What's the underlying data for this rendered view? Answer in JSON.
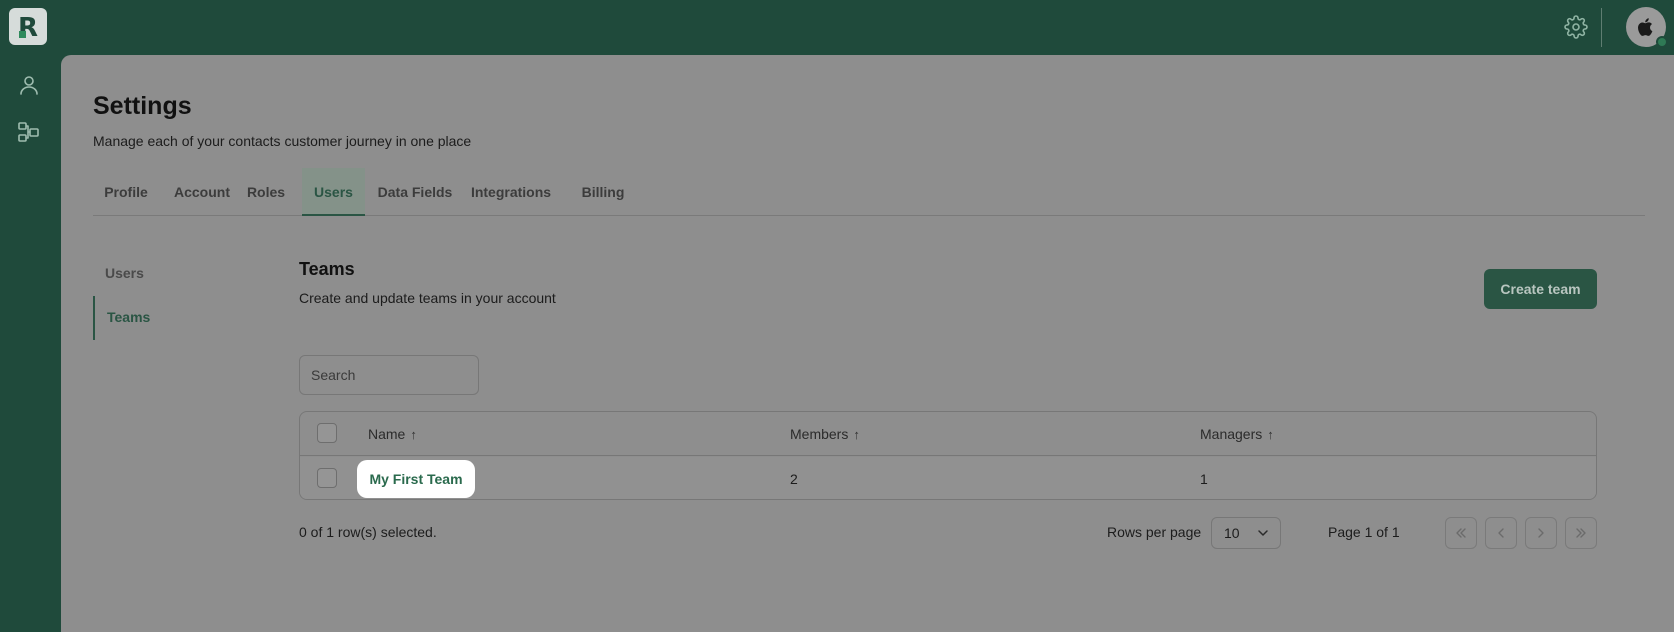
{
  "topbar": {
    "logo_letter": "R",
    "icons": [
      "gear-icon",
      "apple-icon"
    ]
  },
  "rail": {
    "icons": [
      "user-icon",
      "org-chart-icon"
    ]
  },
  "page": {
    "title": "Settings",
    "subtitle": "Manage each of your contacts customer journey in one place"
  },
  "tabs": [
    {
      "label": "Profile",
      "active": false
    },
    {
      "label": "Account",
      "active": false
    },
    {
      "label": "Roles",
      "active": false
    },
    {
      "label": "Users",
      "active": true
    },
    {
      "label": "Data Fields",
      "active": false
    },
    {
      "label": "Integrations",
      "active": false
    },
    {
      "label": "Billing",
      "active": false
    }
  ],
  "subnav": [
    {
      "label": "Users",
      "active": false
    },
    {
      "label": "Teams",
      "active": true
    }
  ],
  "section": {
    "title": "Teams",
    "subtitle": "Create and update teams in your account",
    "create_button": "Create team"
  },
  "search": {
    "placeholder": "Search"
  },
  "table": {
    "columns": [
      "Name",
      "Members",
      "Managers"
    ],
    "rows": [
      {
        "name": "My First Team",
        "members": "2",
        "managers": "1"
      }
    ]
  },
  "footer": {
    "selection": "0 of 1 row(s) selected.",
    "rows_per_page_label": "Rows per page",
    "rows_per_page_value": "10",
    "page_status": "Page 1 of 1"
  },
  "colors": {
    "brand_green": "#1f4a3b",
    "accent_green": "#2a5544",
    "link_green": "#2a6a4d"
  }
}
